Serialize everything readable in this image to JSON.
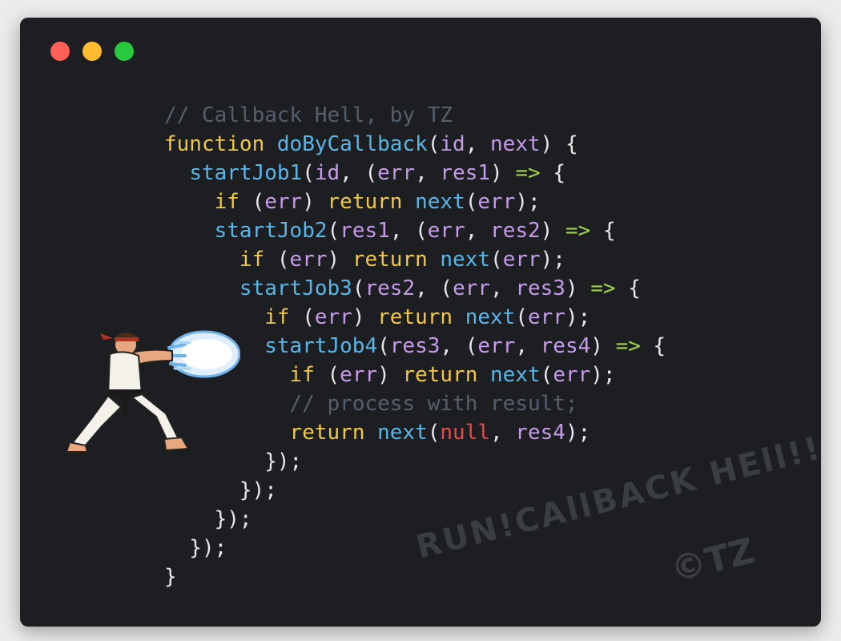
{
  "window": {
    "controls": [
      "close",
      "minimize",
      "maximize"
    ],
    "colors": {
      "background": "#1c1e21",
      "close": "#ff5f56",
      "minimize": "#ffbd2e",
      "maximize": "#27c93f"
    }
  },
  "code": {
    "lines": [
      [
        [
          "comment",
          "// Callback Hell, by TZ"
        ]
      ],
      [
        [
          "keyword",
          "function"
        ],
        [
          "plain",
          " "
        ],
        [
          "func",
          "doByCallback"
        ],
        [
          "plain",
          "("
        ],
        [
          "param",
          "id"
        ],
        [
          "plain",
          ", "
        ],
        [
          "param",
          "next"
        ],
        [
          "plain",
          ") {"
        ]
      ],
      [
        [
          "plain",
          "  "
        ],
        [
          "func",
          "startJob1"
        ],
        [
          "plain",
          "("
        ],
        [
          "param",
          "id"
        ],
        [
          "plain",
          ", ("
        ],
        [
          "param",
          "err"
        ],
        [
          "plain",
          ", "
        ],
        [
          "param",
          "res1"
        ],
        [
          "plain",
          ") "
        ],
        [
          "arrow",
          "=>"
        ],
        [
          "plain",
          " {"
        ]
      ],
      [
        [
          "plain",
          "    "
        ],
        [
          "keyword",
          "if"
        ],
        [
          "plain",
          " ("
        ],
        [
          "param",
          "err"
        ],
        [
          "plain",
          ") "
        ],
        [
          "keyword",
          "return"
        ],
        [
          "plain",
          " "
        ],
        [
          "func",
          "next"
        ],
        [
          "plain",
          "("
        ],
        [
          "param",
          "err"
        ],
        [
          "plain",
          ");"
        ]
      ],
      [
        [
          "plain",
          "    "
        ],
        [
          "func",
          "startJob2"
        ],
        [
          "plain",
          "("
        ],
        [
          "param",
          "res1"
        ],
        [
          "plain",
          ", ("
        ],
        [
          "param",
          "err"
        ],
        [
          "plain",
          ", "
        ],
        [
          "param",
          "res2"
        ],
        [
          "plain",
          ") "
        ],
        [
          "arrow",
          "=>"
        ],
        [
          "plain",
          " {"
        ]
      ],
      [
        [
          "plain",
          "      "
        ],
        [
          "keyword",
          "if"
        ],
        [
          "plain",
          " ("
        ],
        [
          "param",
          "err"
        ],
        [
          "plain",
          ") "
        ],
        [
          "keyword",
          "return"
        ],
        [
          "plain",
          " "
        ],
        [
          "func",
          "next"
        ],
        [
          "plain",
          "("
        ],
        [
          "param",
          "err"
        ],
        [
          "plain",
          ");"
        ]
      ],
      [
        [
          "plain",
          "      "
        ],
        [
          "func",
          "startJob3"
        ],
        [
          "plain",
          "("
        ],
        [
          "param",
          "res2"
        ],
        [
          "plain",
          ", ("
        ],
        [
          "param",
          "err"
        ],
        [
          "plain",
          ", "
        ],
        [
          "param",
          "res3"
        ],
        [
          "plain",
          ") "
        ],
        [
          "arrow",
          "=>"
        ],
        [
          "plain",
          " {"
        ]
      ],
      [
        [
          "plain",
          "        "
        ],
        [
          "keyword",
          "if"
        ],
        [
          "plain",
          " ("
        ],
        [
          "param",
          "err"
        ],
        [
          "plain",
          ") "
        ],
        [
          "keyword",
          "return"
        ],
        [
          "plain",
          " "
        ],
        [
          "func",
          "next"
        ],
        [
          "plain",
          "("
        ],
        [
          "param",
          "err"
        ],
        [
          "plain",
          ");"
        ]
      ],
      [
        [
          "plain",
          "        "
        ],
        [
          "func",
          "startJob4"
        ],
        [
          "plain",
          "("
        ],
        [
          "param",
          "res3"
        ],
        [
          "plain",
          ", ("
        ],
        [
          "param",
          "err"
        ],
        [
          "plain",
          ", "
        ],
        [
          "param",
          "res4"
        ],
        [
          "plain",
          ") "
        ],
        [
          "arrow",
          "=>"
        ],
        [
          "plain",
          " {"
        ]
      ],
      [
        [
          "plain",
          "          "
        ],
        [
          "keyword",
          "if"
        ],
        [
          "plain",
          " ("
        ],
        [
          "param",
          "err"
        ],
        [
          "plain",
          ") "
        ],
        [
          "keyword",
          "return"
        ],
        [
          "plain",
          " "
        ],
        [
          "func",
          "next"
        ],
        [
          "plain",
          "("
        ],
        [
          "param",
          "err"
        ],
        [
          "plain",
          ");"
        ]
      ],
      [
        [
          "plain",
          "          "
        ],
        [
          "comment",
          "// process with result;"
        ]
      ],
      [
        [
          "plain",
          "          "
        ],
        [
          "keyword",
          "return"
        ],
        [
          "plain",
          " "
        ],
        [
          "func",
          "next"
        ],
        [
          "plain",
          "("
        ],
        [
          "null",
          "null"
        ],
        [
          "plain",
          ", "
        ],
        [
          "param",
          "res4"
        ],
        [
          "plain",
          ");"
        ]
      ],
      [
        [
          "plain",
          "        });"
        ]
      ],
      [
        [
          "plain",
          "      });"
        ]
      ],
      [
        [
          "plain",
          "    });"
        ]
      ],
      [
        [
          "plain",
          "  });"
        ]
      ],
      [
        [
          "plain",
          "}"
        ]
      ]
    ]
  },
  "illustration": {
    "name": "fighter-hadouken"
  },
  "watermark": {
    "text": "RUN!CAllBACK HEll!!!",
    "copyright": "©TZ"
  }
}
